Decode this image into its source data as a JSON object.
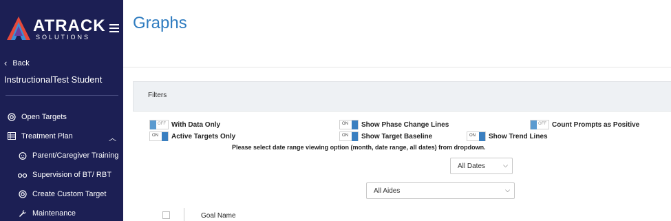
{
  "sidebar": {
    "logo_main": "ATRACK",
    "logo_sub": "SOLUTIONS",
    "back_label": "Back",
    "student_name": "InstructionalTest Student",
    "items": [
      {
        "label": "Open Targets",
        "icon": "target-icon"
      },
      {
        "label": "Treatment Plan",
        "icon": "table-icon"
      },
      {
        "label": "Parent/Caregiver Training",
        "icon": "baby-icon"
      },
      {
        "label": "Supervision of BT/ RBT",
        "icon": "glasses-icon"
      },
      {
        "label": "Create Custom Target",
        "icon": "target-icon"
      },
      {
        "label": "Maintenance",
        "icon": "wrench-icon"
      }
    ]
  },
  "main": {
    "title": "Graphs",
    "filters_label": "Filters",
    "toggles": [
      {
        "label": "With Data Only",
        "state": "OFF"
      },
      {
        "label": "Active Targets Only",
        "state": "ON"
      },
      {
        "label": "Show Phase Change Lines",
        "state": "ON"
      },
      {
        "label": "Show Target Baseline",
        "state": "ON"
      },
      {
        "label": "Show Trend Lines",
        "state": "ON"
      },
      {
        "label": "Count Prompts as Positive",
        "state": "OFF"
      }
    ],
    "date_note": "Please select date range viewing option (month, date range, all dates) from dropdown.",
    "date_select": "All Dates",
    "aide_select": "All Aides",
    "table_header_goal": "Goal Name"
  },
  "colors": {
    "sidebar_bg": "#1c1f54",
    "title_blue": "#2f7cc0",
    "toggle_knob": "#3a7fc0"
  }
}
